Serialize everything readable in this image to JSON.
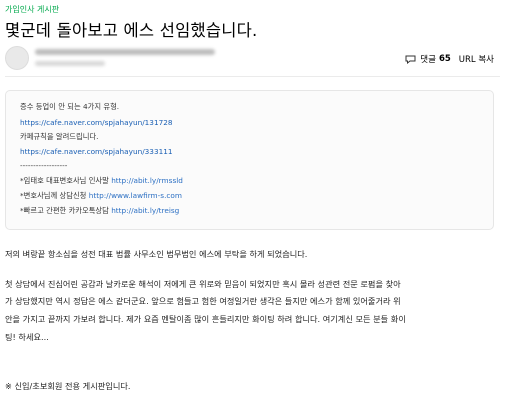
{
  "board": {
    "label": "가입인사 게시판"
  },
  "post": {
    "title": "몇군데 돌아보고 에스 선임했습니다.",
    "comment_label": "댓글",
    "comment_count": "65",
    "url_copy_label": "URL 복사"
  },
  "quote": {
    "line1": "증수 등업이 안 되는 4가지 유형.",
    "link1": "https://cafe.naver.com/spjahayun/131728",
    "line2": "카페규칙을 알려드립니다.",
    "link2": "https://cafe.naver.com/spjahayun/333111",
    "separator": "------------------",
    "row1_text": "*임태호 대표변호사님 인사말",
    "row1_url": "http://abit.ly/rmssld",
    "row2_text": "*변호사님께 상담신청",
    "row2_url": "http://www.lawfirm-s.com",
    "row3_text": "*빠르고 간편한 카카오톡상담",
    "row3_url": "http://abit.ly/treisg"
  },
  "body": {
    "p1": "저의 벼랑끝 항소심을 성전 대표 법률 사무소인 법무법인 에스에 부탁을 하게 되었습니다.",
    "p2_l1": "첫 상담에서 진심어린 공감과 날카로운 해석이 저에게 큰 위로와 믿음이 되었지만 혹시 몰라 성관련 전문 로펌을 찾아",
    "p2_l2": "가 상담했지만 역시 정답은 에스 같더군요. 앞으로 험들고 험한 여정일거란 생각은 들지만 에스가 함께 있어줄거라 위",
    "p2_l3": "안을 가지고 끝까지 가보려 합니다. 제가 요즘 멘탈이좀 많이 흔들리지만 화이팅 하려 합니다. 여기계신 모든 분들 화이",
    "p2_l4": "팅! 하세요...",
    "footer_note": "※ 신입/초보회원 전용 게시판입니다."
  }
}
